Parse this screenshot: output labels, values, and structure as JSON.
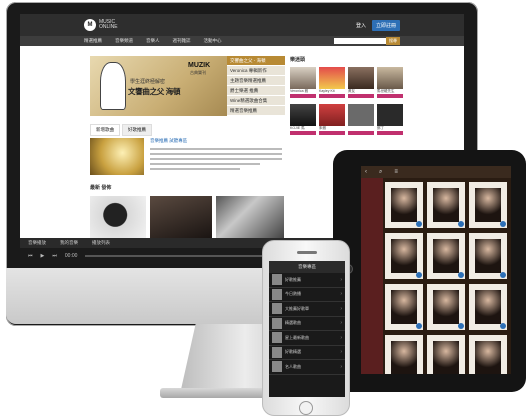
{
  "desktop": {
    "logo_badge": "M",
    "logo_text_1": "MUSIC",
    "logo_text_2": "ONLINE",
    "login": "登入",
    "join": "立即註冊",
    "nav": [
      "精選推薦",
      "音樂頻道",
      "音樂人",
      "週刊雜誌",
      "活動中心"
    ],
    "search_button": "搜尋",
    "hero": {
      "title": "文響曲之父  海頓",
      "subtitle": "學生涯終極解密",
      "brand": "MUZIK",
      "brand_sub": "古典樂刊"
    },
    "hero_menu": [
      "交響曲之父 - 海頓",
      "Veronica 專輯新作",
      "主題音樂精選推薦",
      "爵士樂選 推薦",
      "Wine精選歌曲合集",
      "精選音樂推薦"
    ],
    "tabs": [
      "新增歌曲",
      "好歌推薦"
    ],
    "article": {
      "title": "音樂推薦 試聽專區"
    },
    "section_title": "最新 發佈",
    "right_title": "樂迷頭",
    "artists": [
      "Veronica 雅",
      "Kayley Kit",
      "黃友",
      "馬世龍先生",
      "KOJIE 馬",
      "朱雅",
      "",
      "鄭丁"
    ],
    "follow": "關注",
    "player": {
      "tabs": [
        "音樂播放",
        "我的音樂",
        "播放列表"
      ],
      "time": "00:00"
    }
  },
  "tablet": {
    "header_icons": [
      "back-icon",
      "search-icon",
      "menu-icon"
    ]
  },
  "phone": {
    "header": "音樂專區",
    "rows": [
      "好歌推薦",
      "今日熱播",
      "大推薦好歌單",
      "精選歌曲",
      "星上最新歌曲",
      "好歌精選",
      "名人歌曲"
    ]
  },
  "colors": {
    "accent": "#b88a34",
    "link": "#2d6fb6",
    "pink": "#c0306e"
  }
}
